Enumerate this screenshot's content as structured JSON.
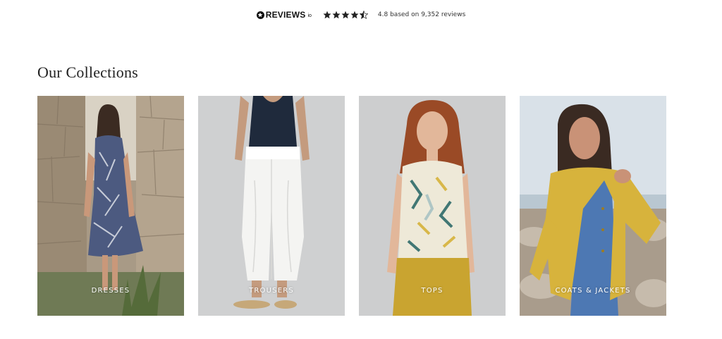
{
  "reviews": {
    "logo_text": "REVIEWS",
    "logo_suffix": "io",
    "rating_stars": 4.5,
    "summary": "4.8 based on 9,352 reviews"
  },
  "collections": {
    "title": "Our Collections",
    "items": [
      {
        "label": "DRESSES"
      },
      {
        "label": "TROUSERS"
      },
      {
        "label": "TOPS"
      },
      {
        "label": "COATS & JACKETS"
      }
    ]
  }
}
